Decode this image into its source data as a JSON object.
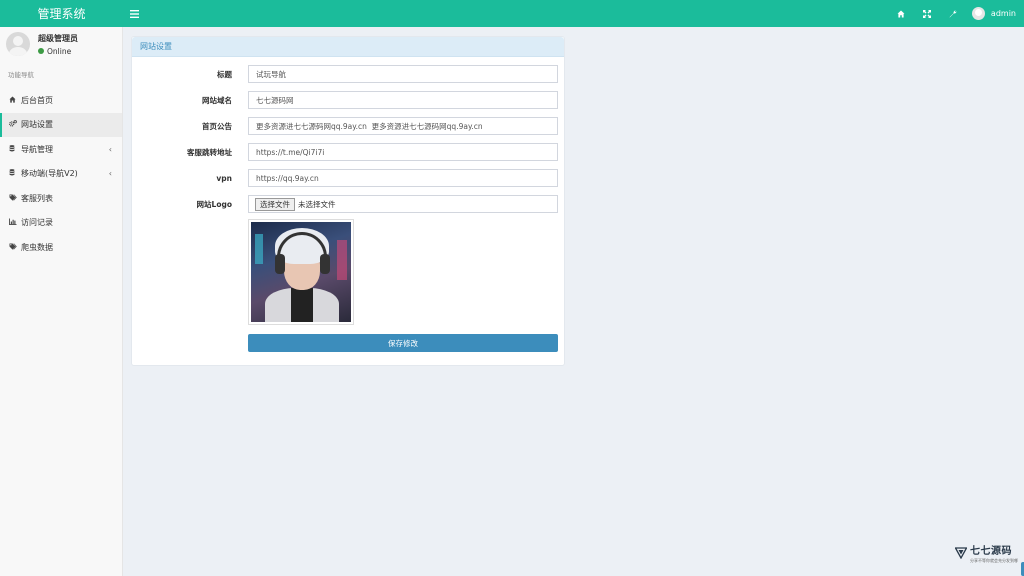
{
  "app": {
    "brand": "管理系统"
  },
  "topbar": {
    "menu_icon": "hamburger-icon",
    "icons": [
      "home-icon",
      "fullscreen-icon",
      "wrench-icon"
    ],
    "user_name": "admin"
  },
  "sidebar": {
    "user": {
      "name": "超级管理员",
      "status": "Online",
      "status_color": "#3c9a44"
    },
    "section_header": "功能导航",
    "items": [
      {
        "label": "后台首页",
        "icon": "home-icon",
        "active": false,
        "has_children": false
      },
      {
        "label": "网站设置",
        "icon": "cogs-icon",
        "active": true,
        "has_children": false
      },
      {
        "label": "导航管理",
        "icon": "database-icon",
        "active": false,
        "has_children": true
      },
      {
        "label": "移动端(导航V2)",
        "icon": "database-icon",
        "active": false,
        "has_children": true
      },
      {
        "label": "客服列表",
        "icon": "tags-icon",
        "active": false,
        "has_children": false
      },
      {
        "label": "访问记录",
        "icon": "bar-chart-icon",
        "active": false,
        "has_children": false
      },
      {
        "label": "爬虫数据",
        "icon": "tags-icon",
        "active": false,
        "has_children": false
      }
    ]
  },
  "main": {
    "box_title": "网站设置",
    "fields": [
      {
        "label": "标题",
        "value": "试玩导航"
      },
      {
        "label": "网站域名",
        "value": "七七源码网"
      },
      {
        "label": "首页公告",
        "value": "更多资源进七七源码网qq.9ay.cn  更多资源进七七源码网qq.9ay.cn"
      },
      {
        "label": "客服跳转地址",
        "value": "https://t.me/Qi7i7i"
      },
      {
        "label": "vpn",
        "value": "https://qq.9ay.cn"
      }
    ],
    "logo": {
      "label": "网站Logo",
      "button": "选择文件",
      "file_text": "未选择文件"
    },
    "save_label": "保存修改"
  },
  "watermark": {
    "title": "七七源码",
    "subtitle": "分享不等你就会充分发到哪"
  },
  "colors": {
    "accent": "#1bbc9b",
    "primary": "#3c8dbc",
    "box_header": "#dcecf7"
  }
}
